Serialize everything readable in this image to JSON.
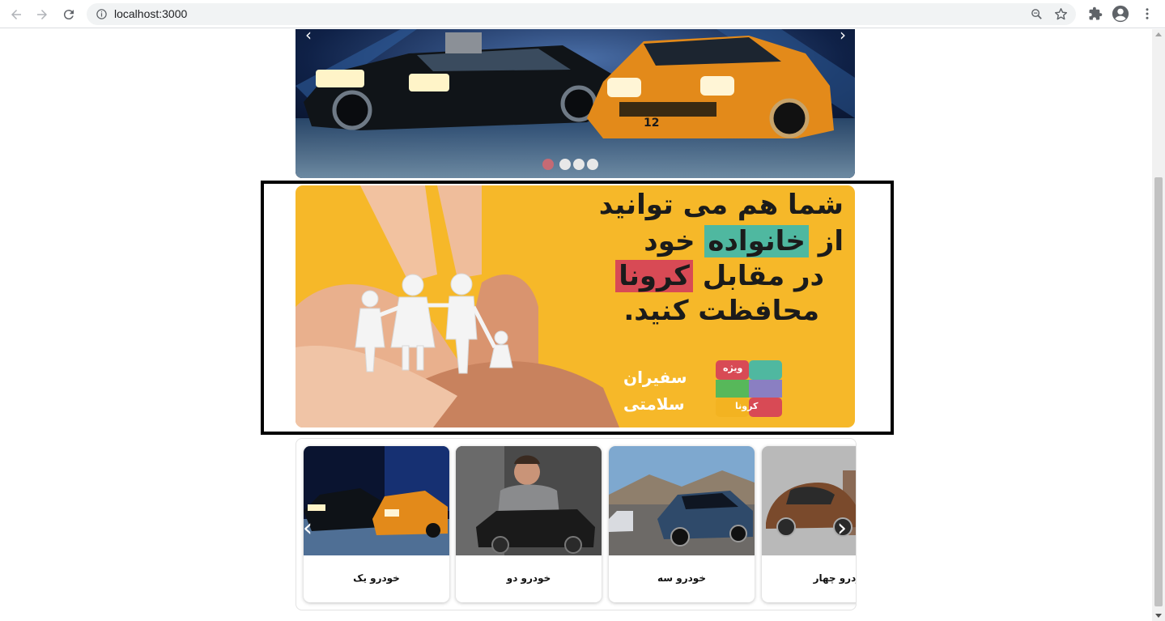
{
  "browser": {
    "url": "localhost:3000",
    "back_icon": "arrow-left-icon",
    "forward_icon": "arrow-right-icon",
    "reload_icon": "reload-icon",
    "info_icon": "info-icon",
    "zoom_icon": "zoom-icon",
    "bookmark_icon": "star-icon",
    "extensions_icon": "puzzle-icon",
    "profile_icon": "account-icon",
    "menu_icon": "more-vert-icon"
  },
  "hero": {
    "prev_glyph": "‹",
    "next_glyph": "›",
    "slide_count": 4,
    "active_slide": 1,
    "active_dot_color": "#c56a74"
  },
  "promo": {
    "line1": "شما هم می توانید",
    "line2_prefix": "از",
    "line2_highlight": "خانواده",
    "line2_suffix": "خود",
    "line3_prefix": "در مقابل",
    "line3_highlight": "کرونا",
    "line4": "محافظت کنید.",
    "logo_top": "سفیران",
    "logo_bottom": "سلامتی",
    "badge_top": "ویژه",
    "badge_bottom": "کرونا",
    "highlight_green": "#4fb8a0",
    "highlight_red": "#d84a55",
    "background": "#f6b829"
  },
  "cards": {
    "prev_glyph": "‹",
    "next_glyph": "›",
    "items": [
      {
        "title": "خودرو یک"
      },
      {
        "title": "خودرو دو"
      },
      {
        "title": "خودرو سه"
      },
      {
        "title": "خودرو چهار"
      }
    ]
  }
}
